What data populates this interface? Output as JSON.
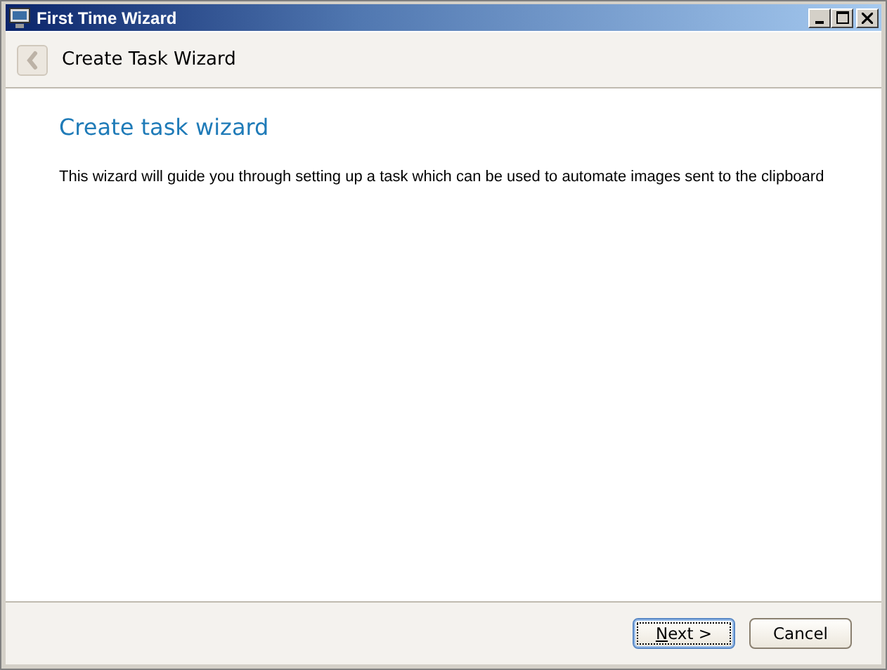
{
  "window": {
    "title": "First Time Wizard"
  },
  "header": {
    "back_disabled": true,
    "title": "Create Task Wizard"
  },
  "content": {
    "heading": "Create task wizard",
    "description": "This wizard will guide you through setting up a task which can be used to automate images sent to the clipboard"
  },
  "buttons": [
    {
      "label": "Next >",
      "default": true
    },
    {
      "label": "Cancel",
      "default": false
    }
  ]
}
